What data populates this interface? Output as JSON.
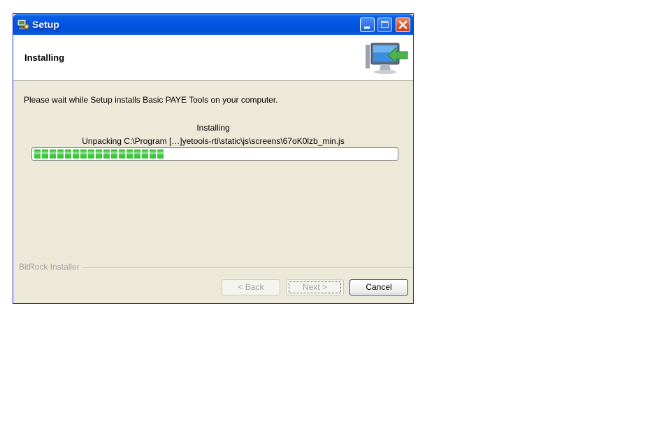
{
  "window": {
    "title": "Setup",
    "buttons": {
      "minimize": "minimize-icon",
      "maximize": "maximize-icon",
      "close": "close-icon"
    }
  },
  "header": {
    "title": "Installing",
    "icon": "install-computer-icon"
  },
  "content": {
    "intro": "Please wait while Setup installs Basic PAYE Tools on your computer.",
    "status_title": "Installing",
    "status_detail": "Unpacking C:\\Program […]yetools-rti\\static\\js\\screens\\67oK0lzb_min.js",
    "progress_percent": 37,
    "progress_color": "#3dc53d"
  },
  "footer": {
    "brand": "BitRock Installer",
    "back_label": "< Back",
    "next_label": "Next >",
    "cancel_label": "Cancel"
  },
  "colors": {
    "titlebar": "#0054e3",
    "dialog_bg": "#ece9d8",
    "close_button": "#c63b16"
  }
}
